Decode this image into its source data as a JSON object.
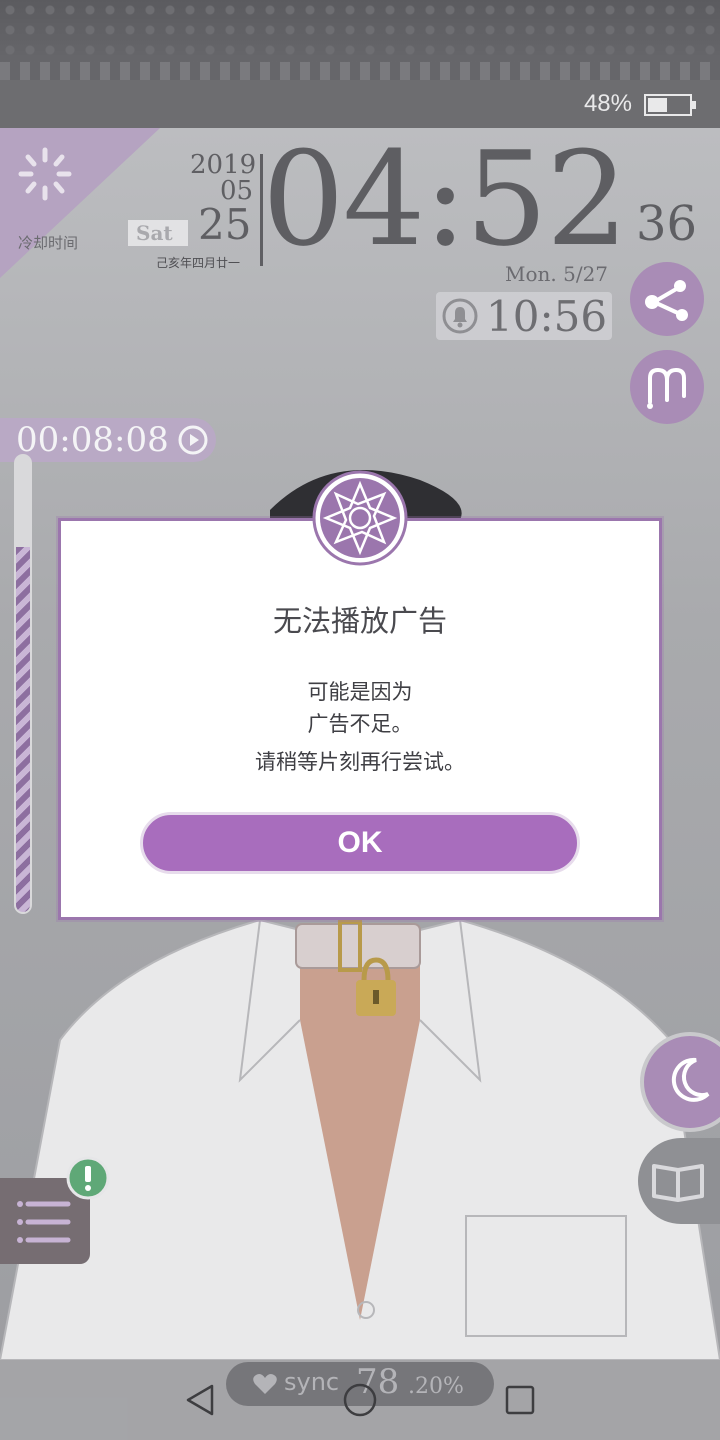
{
  "status_bar": {
    "battery_percent": "48%",
    "battery_level": 0.48
  },
  "cooldown": {
    "label": "冷却时间"
  },
  "date": {
    "year": "2019",
    "month": "05",
    "day": "25",
    "weekday": "Sat",
    "lunar": "己亥年四月廿一"
  },
  "clock": {
    "time": "04:52",
    "seconds": "36",
    "next_alarm_date": "Mon.  5/27",
    "alarm_time": "10:56"
  },
  "timer": {
    "value": "00:08:08",
    "progress": 0.8
  },
  "dialog": {
    "title": "无法播放广告",
    "line1": "可能是因为",
    "line2": "广告不足。",
    "line3": "请稍等片刻再行尝试。",
    "ok_label": "OK"
  },
  "sync": {
    "label": "sync",
    "value": "78",
    "decimal": ".20%"
  },
  "icons": {
    "share": "share-icon",
    "m": "m-icon",
    "moon": "moon-icon",
    "book": "book-icon",
    "menu": "menu-icon",
    "alert": "alert-icon",
    "alarm": "alarm-bell-icon",
    "play": "play-icon",
    "emblem": "flower-emblem-icon"
  },
  "colors": {
    "accent_purple": "#a86dbd",
    "dialog_border": "#9b76ad",
    "alert_green": "#5fa877"
  }
}
